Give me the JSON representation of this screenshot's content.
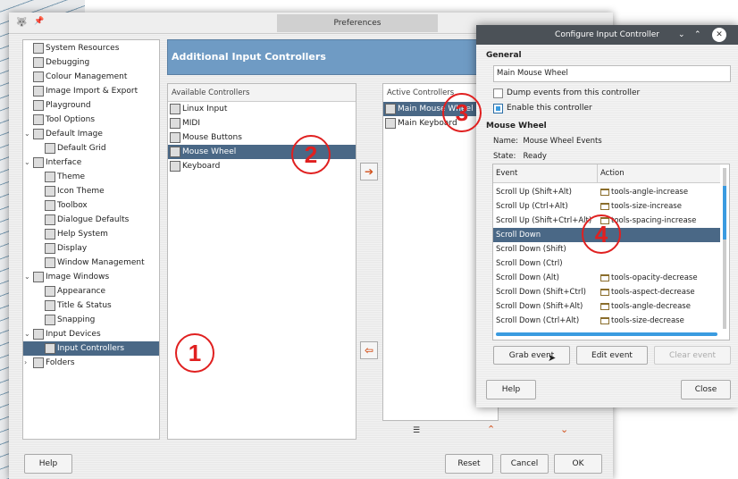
{
  "prefs": {
    "title": "Preferences",
    "tree": [
      {
        "label": "System Resources",
        "level": 0,
        "icon": "system-resources-icon"
      },
      {
        "label": "Debugging",
        "level": 0,
        "icon": "debugging-icon"
      },
      {
        "label": "Colour Management",
        "level": 0,
        "icon": "colour-management-icon"
      },
      {
        "label": "Image Import & Export",
        "level": 0,
        "icon": "image-import-export-icon"
      },
      {
        "label": "Playground",
        "level": 0,
        "icon": "playground-icon"
      },
      {
        "label": "Tool Options",
        "level": 0,
        "icon": "tool-options-icon"
      },
      {
        "label": "Default Image",
        "level": 0,
        "icon": "default-image-icon",
        "expanded": true
      },
      {
        "label": "Default Grid",
        "level": 1,
        "icon": "default-grid-icon"
      },
      {
        "label": "Interface",
        "level": 0,
        "icon": "interface-icon",
        "expanded": true
      },
      {
        "label": "Theme",
        "level": 1,
        "icon": "theme-icon"
      },
      {
        "label": "Icon Theme",
        "level": 1,
        "icon": "icon-theme-icon"
      },
      {
        "label": "Toolbox",
        "level": 1,
        "icon": "toolbox-icon"
      },
      {
        "label": "Dialogue Defaults",
        "level": 1,
        "icon": "dialogue-defaults-icon"
      },
      {
        "label": "Help System",
        "level": 1,
        "icon": "help-system-icon"
      },
      {
        "label": "Display",
        "level": 1,
        "icon": "display-icon"
      },
      {
        "label": "Window Management",
        "level": 1,
        "icon": "window-management-icon"
      },
      {
        "label": "Image Windows",
        "level": 0,
        "icon": "image-windows-icon",
        "expanded": true
      },
      {
        "label": "Appearance",
        "level": 1,
        "icon": "appearance-icon"
      },
      {
        "label": "Title & Status",
        "level": 1,
        "icon": "title-status-icon"
      },
      {
        "label": "Snapping",
        "level": 1,
        "icon": "snapping-icon"
      },
      {
        "label": "Input Devices",
        "level": 0,
        "icon": "input-devices-icon",
        "expanded": true
      },
      {
        "label": "Input Controllers",
        "level": 1,
        "icon": "input-controllers-icon",
        "selected": true
      },
      {
        "label": "Folders",
        "level": 0,
        "icon": "folders-icon",
        "collapsed": true
      }
    ],
    "header": "Additional Input Controllers",
    "available_header": "Available Controllers",
    "available": [
      "Linux Input",
      "MIDI",
      "Mouse Buttons",
      "Mouse Wheel",
      "Keyboard"
    ],
    "available_selected": 3,
    "active_header": "Active Controllers",
    "active": [
      "Main Mouse Wheel",
      "Main Keyboard"
    ],
    "active_selected": 0,
    "buttons": {
      "help": "Help",
      "reset": "Reset",
      "cancel": "Cancel",
      "ok": "OK"
    }
  },
  "dialog": {
    "title": "Configure Input Controller",
    "general": "General",
    "name_value": "Main Mouse Wheel",
    "dump_label": "Dump events from this controller",
    "dump_checked": false,
    "enable_label": "Enable this controller",
    "enable_checked": true,
    "section": "Mouse Wheel",
    "name_label": "Name:",
    "name_text": "Mouse Wheel Events",
    "state_label": "State:",
    "state_text": "Ready",
    "col_event": "Event",
    "col_action": "Action",
    "rows": [
      {
        "event": "Scroll Up (Shift+Alt)",
        "action": "tools-angle-increase"
      },
      {
        "event": "Scroll Up (Ctrl+Alt)",
        "action": "tools-size-increase"
      },
      {
        "event": "Scroll Up (Shift+Ctrl+Alt)",
        "action": "tools-spacing-increase"
      },
      {
        "event": "Scroll Down",
        "action": ""
      },
      {
        "event": "Scroll Down (Shift)",
        "action": ""
      },
      {
        "event": "Scroll Down (Ctrl)",
        "action": ""
      },
      {
        "event": "Scroll Down (Alt)",
        "action": "tools-opacity-decrease"
      },
      {
        "event": "Scroll Down (Shift+Ctrl)",
        "action": "tools-aspect-decrease"
      },
      {
        "event": "Scroll Down (Shift+Alt)",
        "action": "tools-angle-decrease"
      },
      {
        "event": "Scroll Down (Ctrl+Alt)",
        "action": "tools-size-decrease"
      }
    ],
    "selected_row": 3,
    "buttons": {
      "grab": "Grab event",
      "edit": "Edit event",
      "clear": "Clear event",
      "help": "Help",
      "close": "Close"
    }
  },
  "annotations": [
    "1",
    "2",
    "3",
    "4"
  ]
}
